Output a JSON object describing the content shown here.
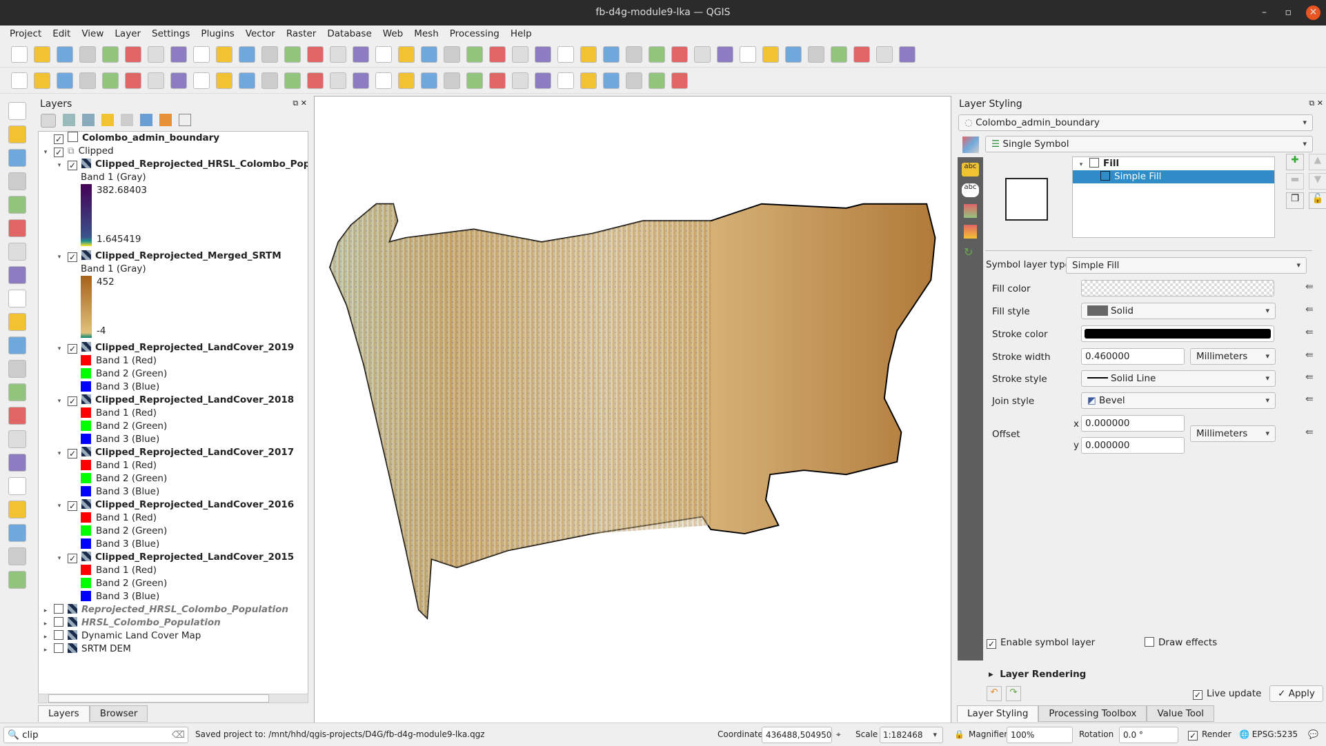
{
  "window": {
    "title": "fb-d4g-module9-lka — QGIS",
    "minimize": "–",
    "maximize": "▫",
    "close": "✕"
  },
  "menu": [
    "Project",
    "Edit",
    "View",
    "Layer",
    "Settings",
    "Plugins",
    "Vector",
    "Raster",
    "Database",
    "Web",
    "Mesh",
    "Processing",
    "Help"
  ],
  "layers_panel": {
    "title": "Layers",
    "items": [
      {
        "label": "Colombo_admin_boundary",
        "checked": true,
        "bold": true
      },
      {
        "label": "Clipped",
        "checked": true,
        "group": true
      },
      {
        "label": "Clipped_Reprojected_HRSL_Colombo_Popu",
        "checked": true,
        "band": "Band 1 (Gray)",
        "max": "382.68403",
        "min": "1.645419"
      },
      {
        "label": "Clipped_Reprojected_Merged_SRTM",
        "checked": true,
        "band": "Band 1 (Gray)",
        "max": "452",
        "min": "-4"
      },
      {
        "label": "Clipped_Reprojected_LandCover_2019",
        "bands": [
          "Band 1 (Red)",
          "Band 2 (Green)",
          "Band 3 (Blue)"
        ]
      },
      {
        "label": "Clipped_Reprojected_LandCover_2018",
        "bands": [
          "Band 1 (Red)",
          "Band 2 (Green)",
          "Band 3 (Blue)"
        ]
      },
      {
        "label": "Clipped_Reprojected_LandCover_2017",
        "bands": [
          "Band 1 (Red)",
          "Band 2 (Green)",
          "Band 3 (Blue)"
        ]
      },
      {
        "label": "Clipped_Reprojected_LandCover_2016",
        "bands": [
          "Band 1 (Red)",
          "Band 2 (Green)",
          "Band 3 (Blue)"
        ]
      },
      {
        "label": "Clipped_Reprojected_LandCover_2015",
        "bands": [
          "Band 1 (Red)",
          "Band 2 (Green)",
          "Band 3 (Blue)"
        ]
      },
      {
        "label": "Reprojected_HRSL_Colombo_Population",
        "checked": false,
        "italic": true
      },
      {
        "label": "HRSL_Colombo_Population",
        "checked": false,
        "italic": true
      },
      {
        "label": "Dynamic Land Cover Map",
        "checked": false
      },
      {
        "label": "SRTM DEM",
        "checked": false
      }
    ],
    "tabs": [
      "Layers",
      "Browser"
    ]
  },
  "styling": {
    "title": "Layer Styling",
    "layer": "Colombo_admin_boundary",
    "renderer": "Single Symbol",
    "tree": {
      "root": "Fill",
      "child": "Simple Fill"
    },
    "symbol_layer_type_label": "Symbol layer type",
    "symbol_layer_type": "Simple Fill",
    "fill_color_label": "Fill color",
    "fill_style_label": "Fill style",
    "fill_style": "Solid",
    "stroke_color_label": "Stroke color",
    "stroke_color": "#000000",
    "stroke_width_label": "Stroke width",
    "stroke_width": "0.460000",
    "stroke_width_unit": "Millimeters",
    "stroke_style_label": "Stroke style",
    "stroke_style": "Solid Line",
    "join_style_label": "Join style",
    "join_style": "Bevel",
    "offset_label": "Offset",
    "offset_x_label": "x",
    "offset_x": "0.000000",
    "offset_y_label": "y",
    "offset_y": "0.000000",
    "offset_unit": "Millimeters",
    "enable_symbol_layer": "Enable symbol layer",
    "draw_effects": "Draw effects",
    "layer_rendering": "Layer Rendering",
    "live_update": "Live update",
    "apply": "Apply",
    "tabs": [
      "Layer Styling",
      "Processing Toolbox",
      "Value Tool"
    ]
  },
  "status": {
    "search": "clip",
    "message": "Saved project to: /mnt/hhd/qgis-projects/D4G/fb-d4g-module9-lka.qgz",
    "coordinate_label": "Coordinate",
    "coordinate": "436488,504950",
    "scale_label": "Scale",
    "scale": "1:182468",
    "magnifier_label": "Magnifier",
    "magnifier": "100%",
    "rotation_label": "Rotation",
    "rotation": "0.0 °",
    "render": "Render",
    "crs": "EPSG:5235"
  },
  "colors": {
    "accent": "#308cc6",
    "band_red": "#ff0000",
    "band_green": "#00ff00",
    "band_blue": "#0000ff",
    "srtm_high": "#a6611a",
    "srtm_low": "#dfc27d"
  }
}
